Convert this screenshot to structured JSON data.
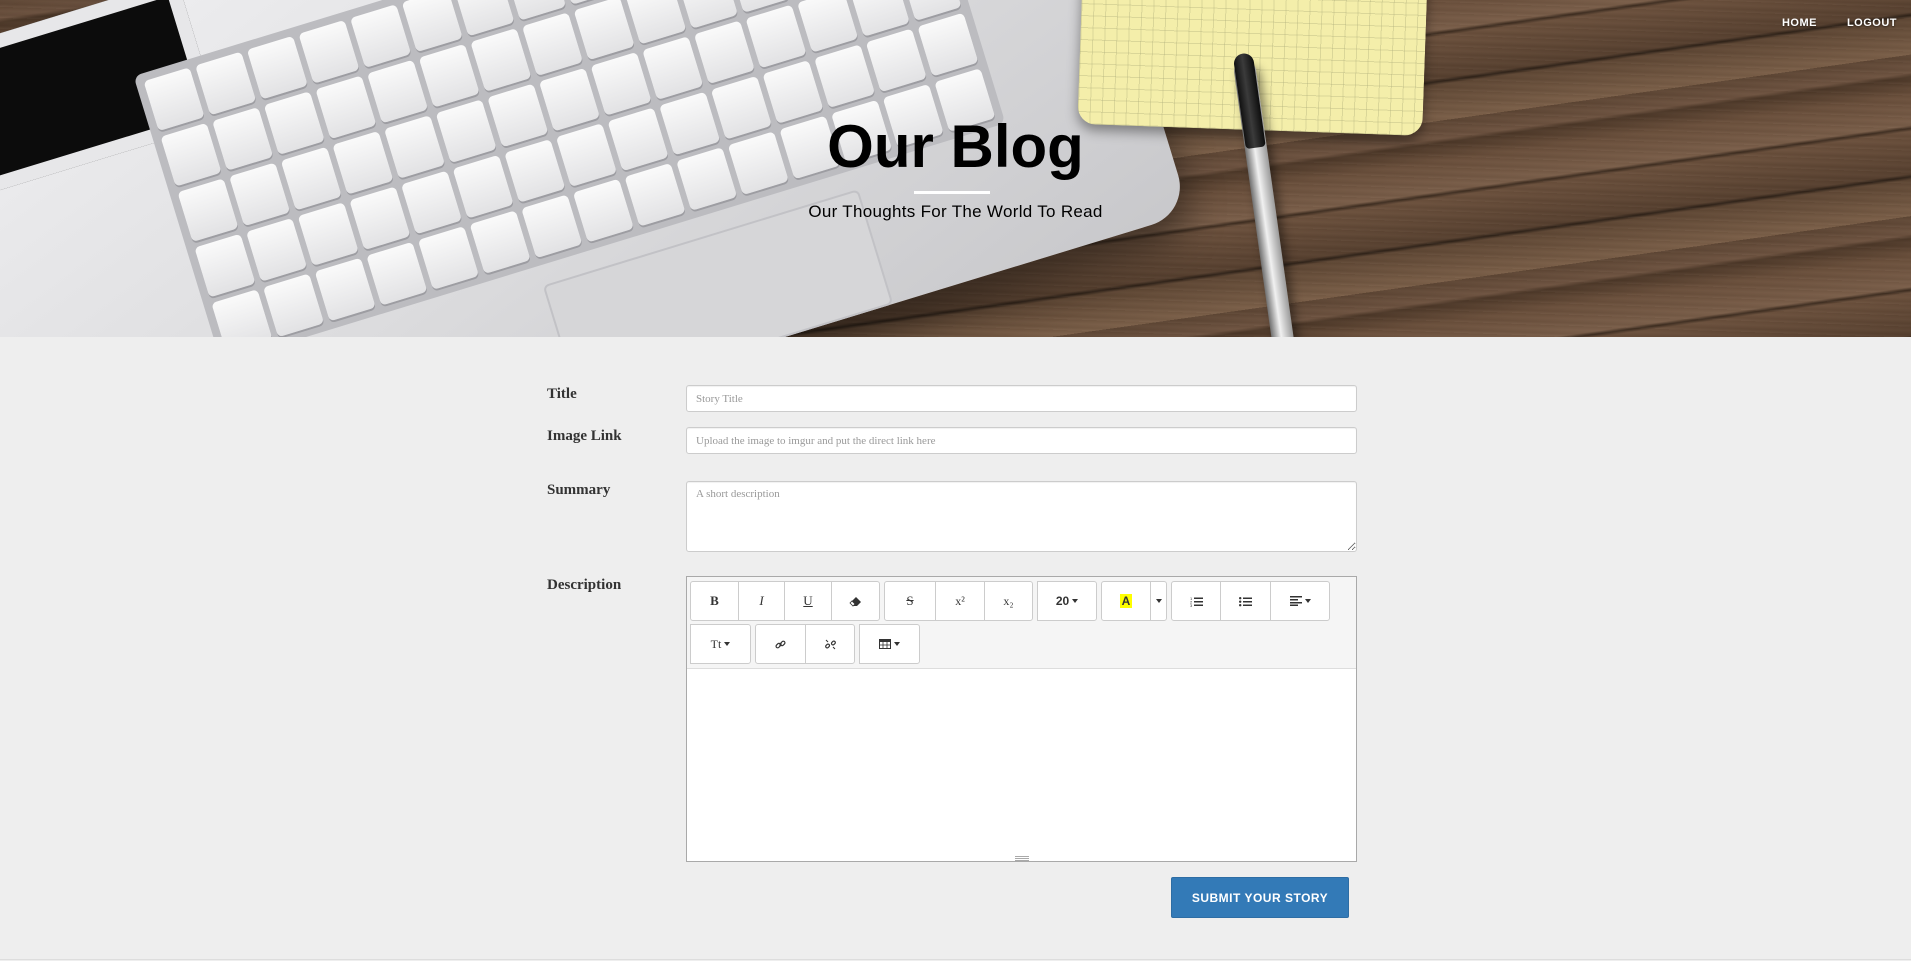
{
  "nav": {
    "home": "HOME",
    "logout": "LOGOUT"
  },
  "hero": {
    "title": "Our Blog",
    "subtitle": "Our Thoughts For The World To Read"
  },
  "form": {
    "title": {
      "label": "Title",
      "placeholder": "Story Title",
      "value": ""
    },
    "image_link": {
      "label": "Image Link",
      "placeholder": "Upload the image to imgur and put the direct link here",
      "value": ""
    },
    "summary": {
      "label": "Summary",
      "placeholder": "A short description",
      "value": ""
    },
    "description": {
      "label": "Description"
    },
    "submit_label": "SUBMIT YOUR STORY"
  },
  "toolbar": {
    "bold": "B",
    "italic": "I",
    "underline": "U",
    "strikethrough": "S",
    "superscript": "x²",
    "subscript": "x₂",
    "font_size": "20",
    "highlight": "A",
    "highlight_color": "#ffff00",
    "font_name": "Tt"
  },
  "icons": {
    "eraser": "eraser-icon",
    "ordered_list": "ordered-list-icon",
    "unordered_list": "unordered-list-icon",
    "align": "align-left-icon",
    "link": "link-icon",
    "unlink": "unlink-icon",
    "table": "table-icon"
  }
}
